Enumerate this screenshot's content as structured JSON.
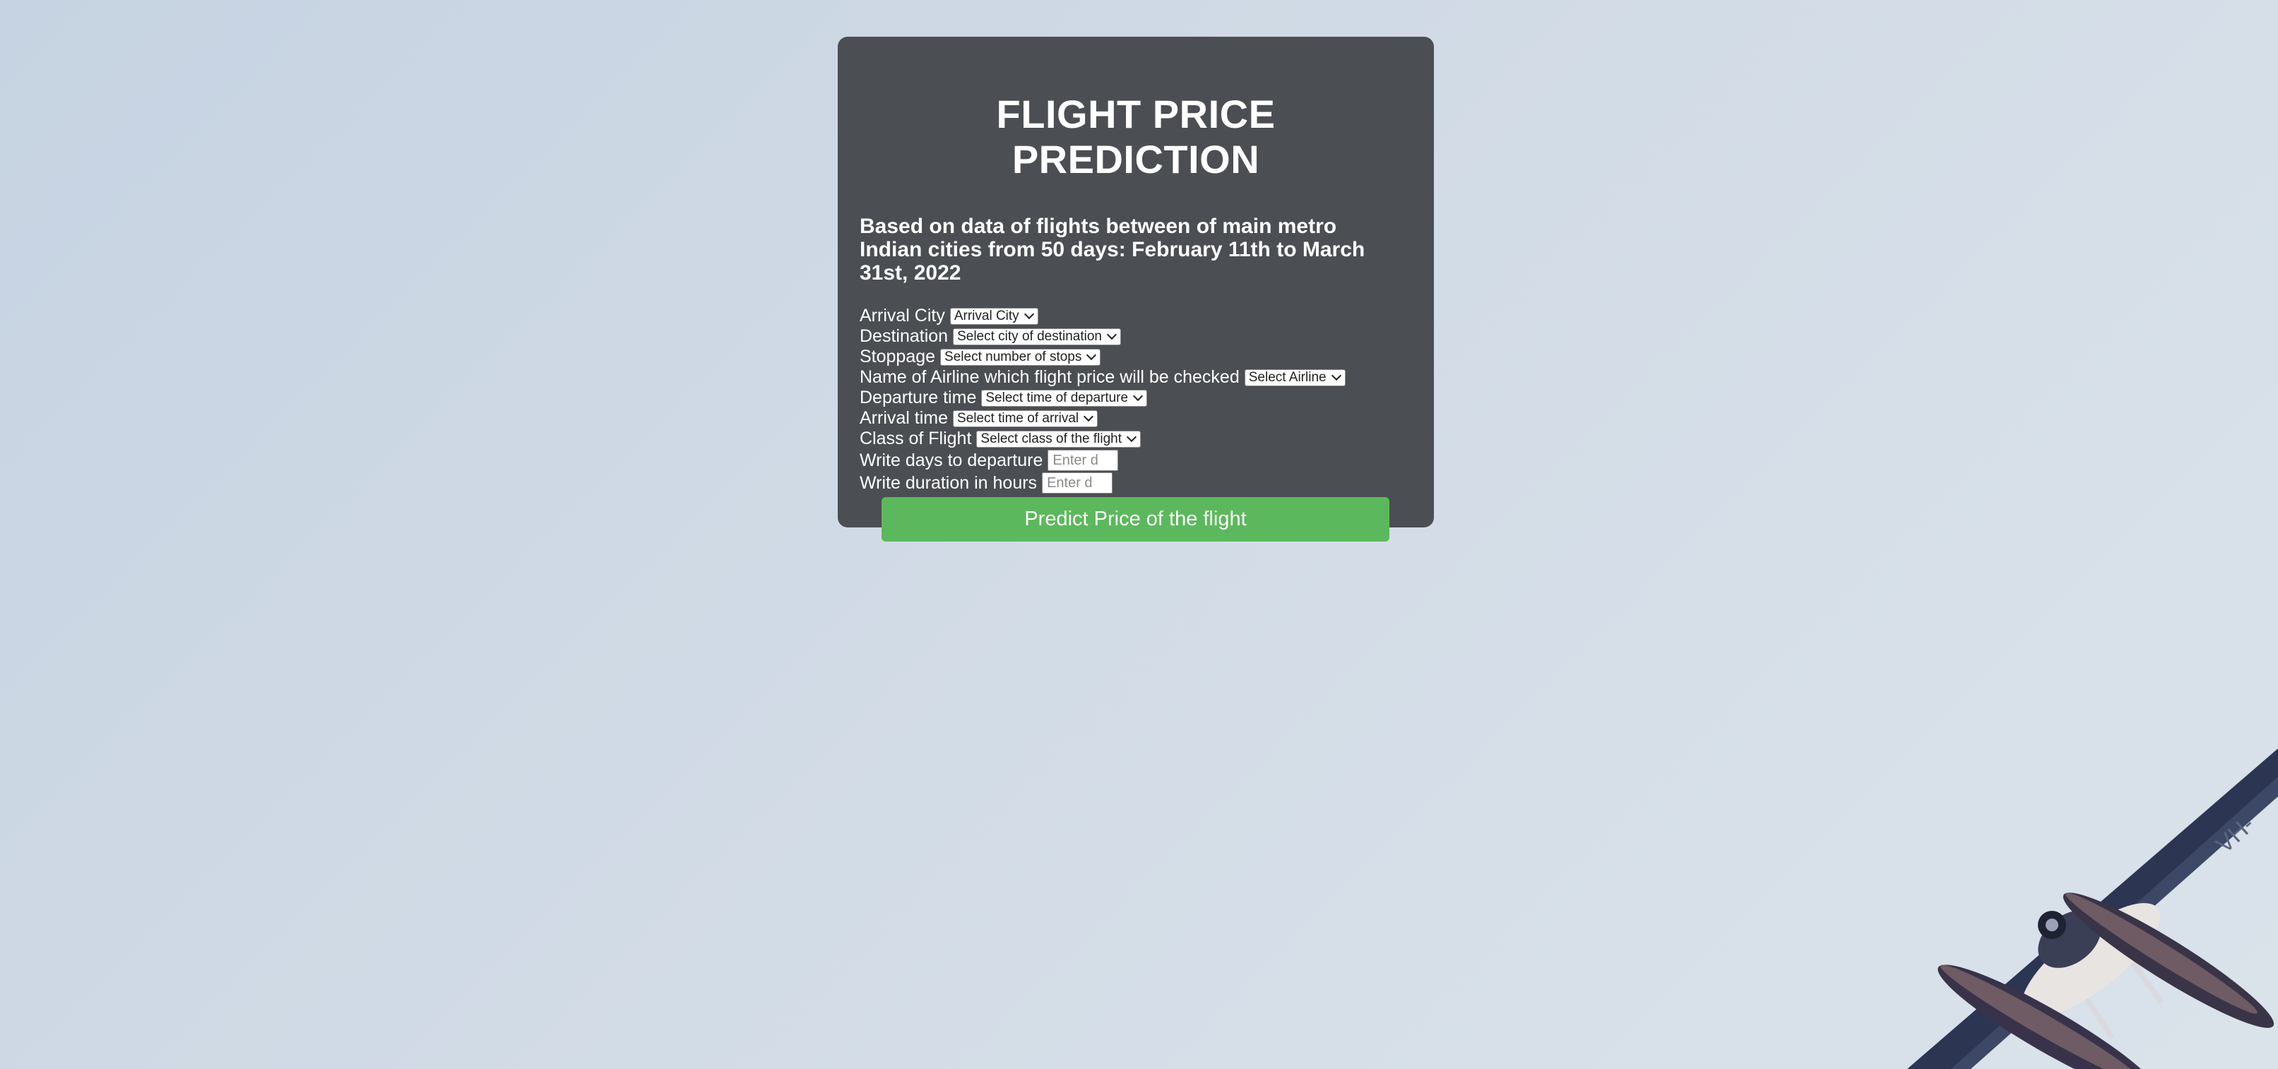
{
  "header": {
    "title": "FLIGHT PRICE PREDICTION",
    "subtitle": "Based on data of flights between of main metro Indian cities from 50 days: February 11th to March 31st, 2022"
  },
  "form": {
    "arrival_city": {
      "label": "Arrival City",
      "selected": "Arrival City"
    },
    "destination": {
      "label": "Destination",
      "selected": "Select city of destination"
    },
    "stoppage": {
      "label": "Stoppage",
      "selected": "Select number of stops"
    },
    "airline": {
      "label": "Name of Airline which flight price will be checked",
      "selected": "Select Airline"
    },
    "departure_time": {
      "label": "Departure time",
      "selected": "Select time of departure"
    },
    "arrival_time": {
      "label": "Arrival time",
      "selected": "Select time of arrival"
    },
    "flight_class": {
      "label": "Class of Flight",
      "selected": "Select class of the flight"
    },
    "days_to_departure": {
      "label": "Write days to departure",
      "placeholder": "Enter d",
      "value": ""
    },
    "duration_hours": {
      "label": "Write duration in hours",
      "placeholder": "Enter d",
      "value": ""
    },
    "submit_label": "Predict Price of the flight"
  },
  "colors": {
    "card_background": "#4b4e52",
    "button_background": "#5cb85c",
    "page_background": "#d2dce7"
  },
  "icons": {
    "dropdown": "chevron-down-icon",
    "background": "seaplane-photo"
  }
}
